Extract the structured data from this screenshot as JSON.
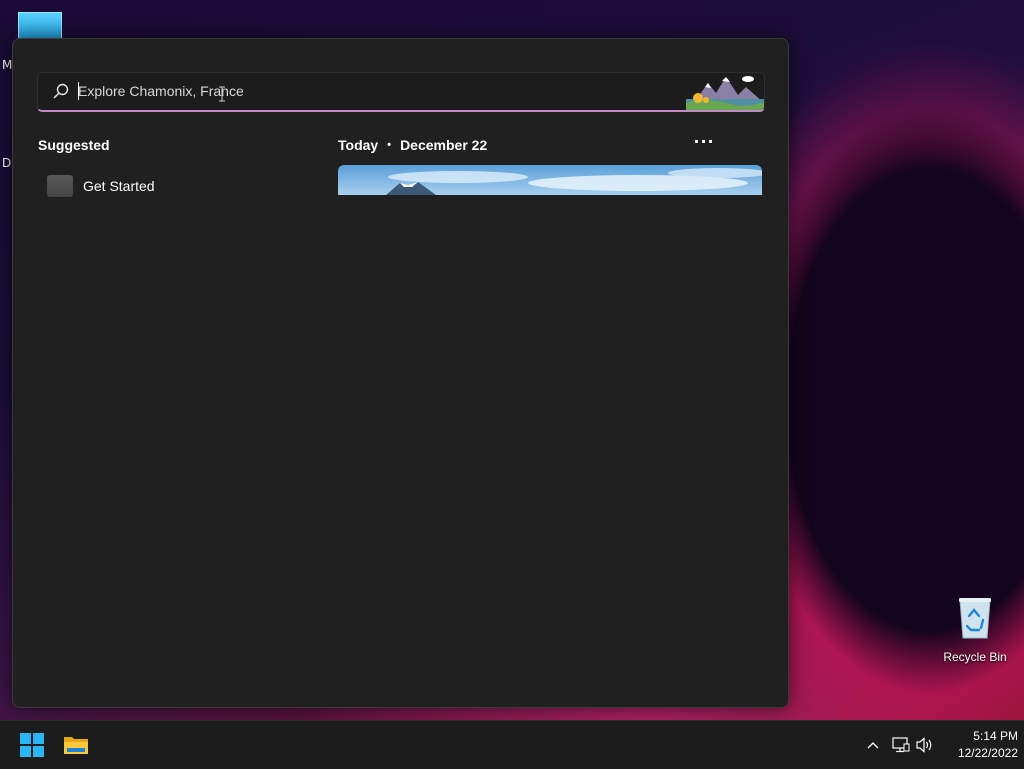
{
  "desktop": {
    "fragment_1": "M",
    "fragment_2": "D",
    "recycle_bin_label": "Recycle Bin"
  },
  "start_menu": {
    "search": {
      "placeholder": "Explore Chamonix, France",
      "icon": "search-icon"
    },
    "suggested": {
      "title": "Suggested",
      "items": [
        {
          "label": "Get Started"
        }
      ]
    },
    "today": {
      "label": "Today",
      "separator": "•",
      "date": "December 22",
      "more_label": "···"
    }
  },
  "taskbar": {
    "start_icon": "windows-start-icon",
    "explorer_icon": "file-explorer-icon",
    "tray": {
      "chevron_icon": "chevron-up-icon",
      "network_icon": "network-icon",
      "volume_icon": "volume-icon"
    },
    "clock": {
      "time": "5:14 PM",
      "date": "12/22/2022"
    }
  },
  "colors": {
    "accent_underline": "#c28ac9",
    "panel_bg": "#202020",
    "taskbar_bg": "#1c1c1c"
  }
}
